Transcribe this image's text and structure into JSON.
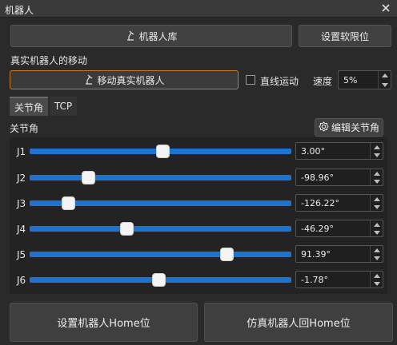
{
  "window": {
    "title": "机器人"
  },
  "header": {
    "robot_lib_label": "机器人库",
    "soft_limit_label": "设置软限位"
  },
  "move": {
    "section_title": "真实机器人的移动",
    "move_button_label": "移动真实机器人",
    "linear_label": "直线运动",
    "linear_checked": false,
    "speed_label": "速度",
    "speed_value": "5%"
  },
  "tabs": [
    {
      "label": "关节角",
      "active": true
    },
    {
      "label": "TCP",
      "active": false
    }
  ],
  "joints_section": {
    "title": "关节角",
    "edit_button_label": "编辑关节角"
  },
  "joints": [
    {
      "label": "J1",
      "value": "3.00°",
      "slider_fraction": 0.508
    },
    {
      "label": "J2",
      "value": "-98.96°",
      "slider_fraction": 0.225
    },
    {
      "label": "J3",
      "value": "-126.22°",
      "slider_fraction": 0.149
    },
    {
      "label": "J4",
      "value": "-46.29°",
      "slider_fraction": 0.371
    },
    {
      "label": "J5",
      "value": "91.39°",
      "slider_fraction": 0.754
    },
    {
      "label": "J6",
      "value": "-1.78°",
      "slider_fraction": 0.495
    }
  ],
  "footer": {
    "set_home_label": "设置机器人Home位",
    "sim_home_label": "仿真机器人回Home位"
  },
  "colors": {
    "slider_track": "#1c74d0",
    "primary_border": "#c8781e",
    "background": "#2a2a2a"
  }
}
